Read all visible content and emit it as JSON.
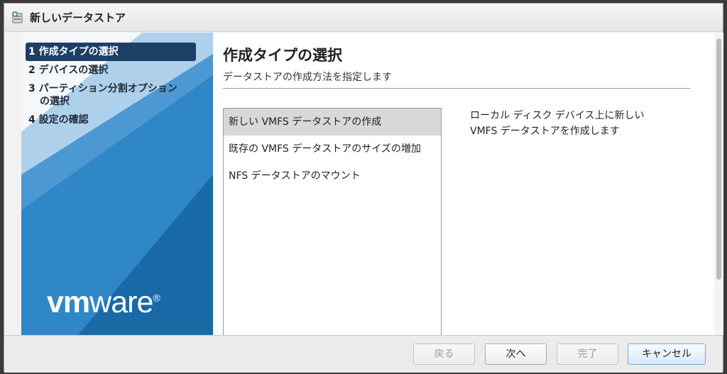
{
  "window": {
    "title": "新しいデータストア",
    "title_icon": "datastore-add-icon"
  },
  "sidebar": {
    "steps": [
      {
        "label": "1 作成タイプの選択",
        "active": true
      },
      {
        "label": "2 デバイスの選択",
        "active": false
      },
      {
        "label_line1": "3 パーティション分割オプション",
        "label_line2": "の選択",
        "active": false
      },
      {
        "label": "4 設定の確認",
        "active": false
      }
    ],
    "logo": {
      "prefix": "vm",
      "suffix": "ware",
      "trademark": "®"
    },
    "colors": {
      "accent": "#1e73b4",
      "active_step": "#1d3f66"
    }
  },
  "main": {
    "heading": "作成タイプの選択",
    "subheading": "データストアの作成方法を指定します",
    "types": [
      {
        "label": "新しい VMFS データストアの作成",
        "selected": true
      },
      {
        "label": "既存の VMFS データストアのサイズの増加",
        "selected": false
      },
      {
        "label": "NFS データストアのマウント",
        "selected": false
      }
    ],
    "description_line1": "ローカル ディスク デバイス上に新しい",
    "description_line2": "VMFS データストアを作成します"
  },
  "footer": {
    "back_label": "戻る",
    "next_label": "次へ",
    "finish_label": "完了",
    "cancel_label": "キャンセル"
  }
}
